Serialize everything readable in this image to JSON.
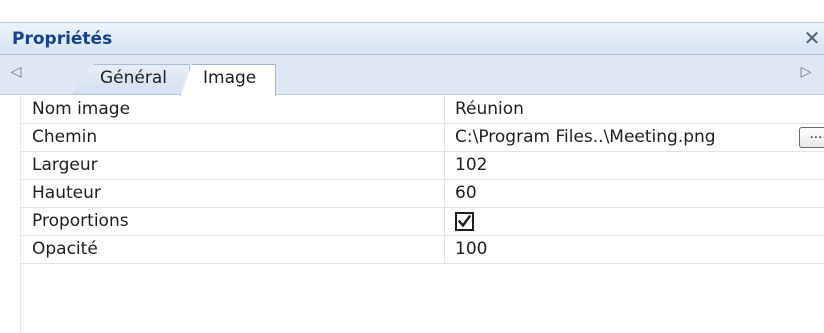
{
  "panel": {
    "title": "Propriétés",
    "close_glyph": "✕"
  },
  "tabs": {
    "nav_left_glyph": "◁",
    "nav_right_glyph": "▷",
    "items": [
      {
        "label": "Général",
        "active": false
      },
      {
        "label": "Image",
        "active": true
      }
    ]
  },
  "properties": [
    {
      "name": "Nom image",
      "value": "Réunion"
    },
    {
      "name": "Chemin",
      "value": "C:\\Program Files..\\Meeting.png",
      "button_label": "..."
    },
    {
      "name": "Largeur",
      "value": "102"
    },
    {
      "name": "Hauteur",
      "value": "60"
    },
    {
      "name": "Proportions",
      "checked": true
    },
    {
      "name": "Opacité",
      "value": "100"
    }
  ],
  "colors": {
    "title_text": "#15428b",
    "header_gradient_top": "#edf3fb",
    "header_gradient_bottom": "#d6e3f3",
    "grid_line": "#e2e2e2"
  }
}
